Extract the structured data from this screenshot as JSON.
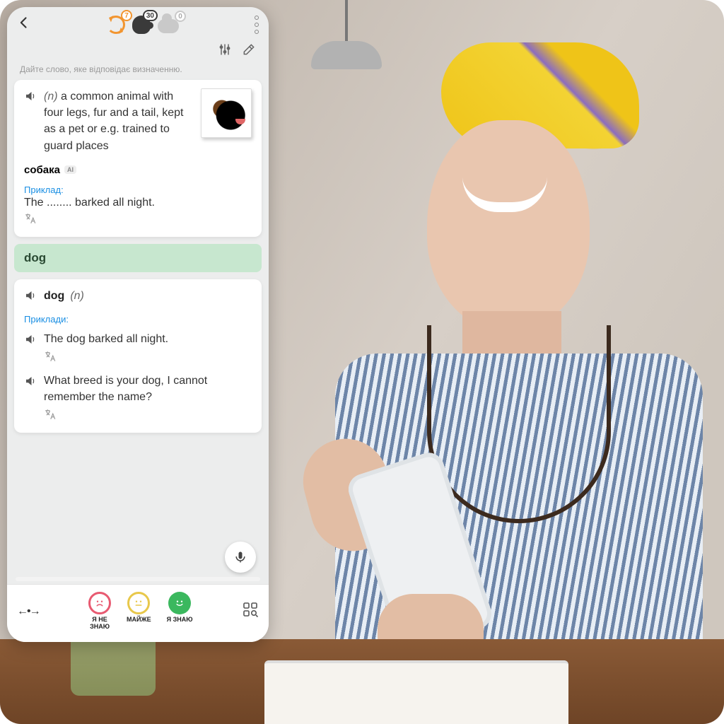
{
  "header": {
    "badges": {
      "refresh": "7",
      "brain": "30",
      "cloud": "0"
    }
  },
  "instruction": "Дайте слово, яке відповідає визначенню.",
  "definition": {
    "pos": "(n)",
    "text": "a common animal with four legs, fur and a tail, kept as a pet or e.g. trained to guard places",
    "translation": "собака",
    "ai_tag": "AI",
    "example_label": "Приклад:",
    "example": "The ........ barked all night."
  },
  "answer": "dog",
  "entry": {
    "word": "dog",
    "pos": "(n)",
    "examples_label": "Приклади:",
    "examples": [
      "The dog barked all night.",
      "What breed is your dog, I cannot remember the name?"
    ]
  },
  "footer": {
    "dont_know": "Я НЕ\nЗНАЮ",
    "almost": "МАЙЖЕ",
    "know": "Я ЗНАЮ"
  }
}
